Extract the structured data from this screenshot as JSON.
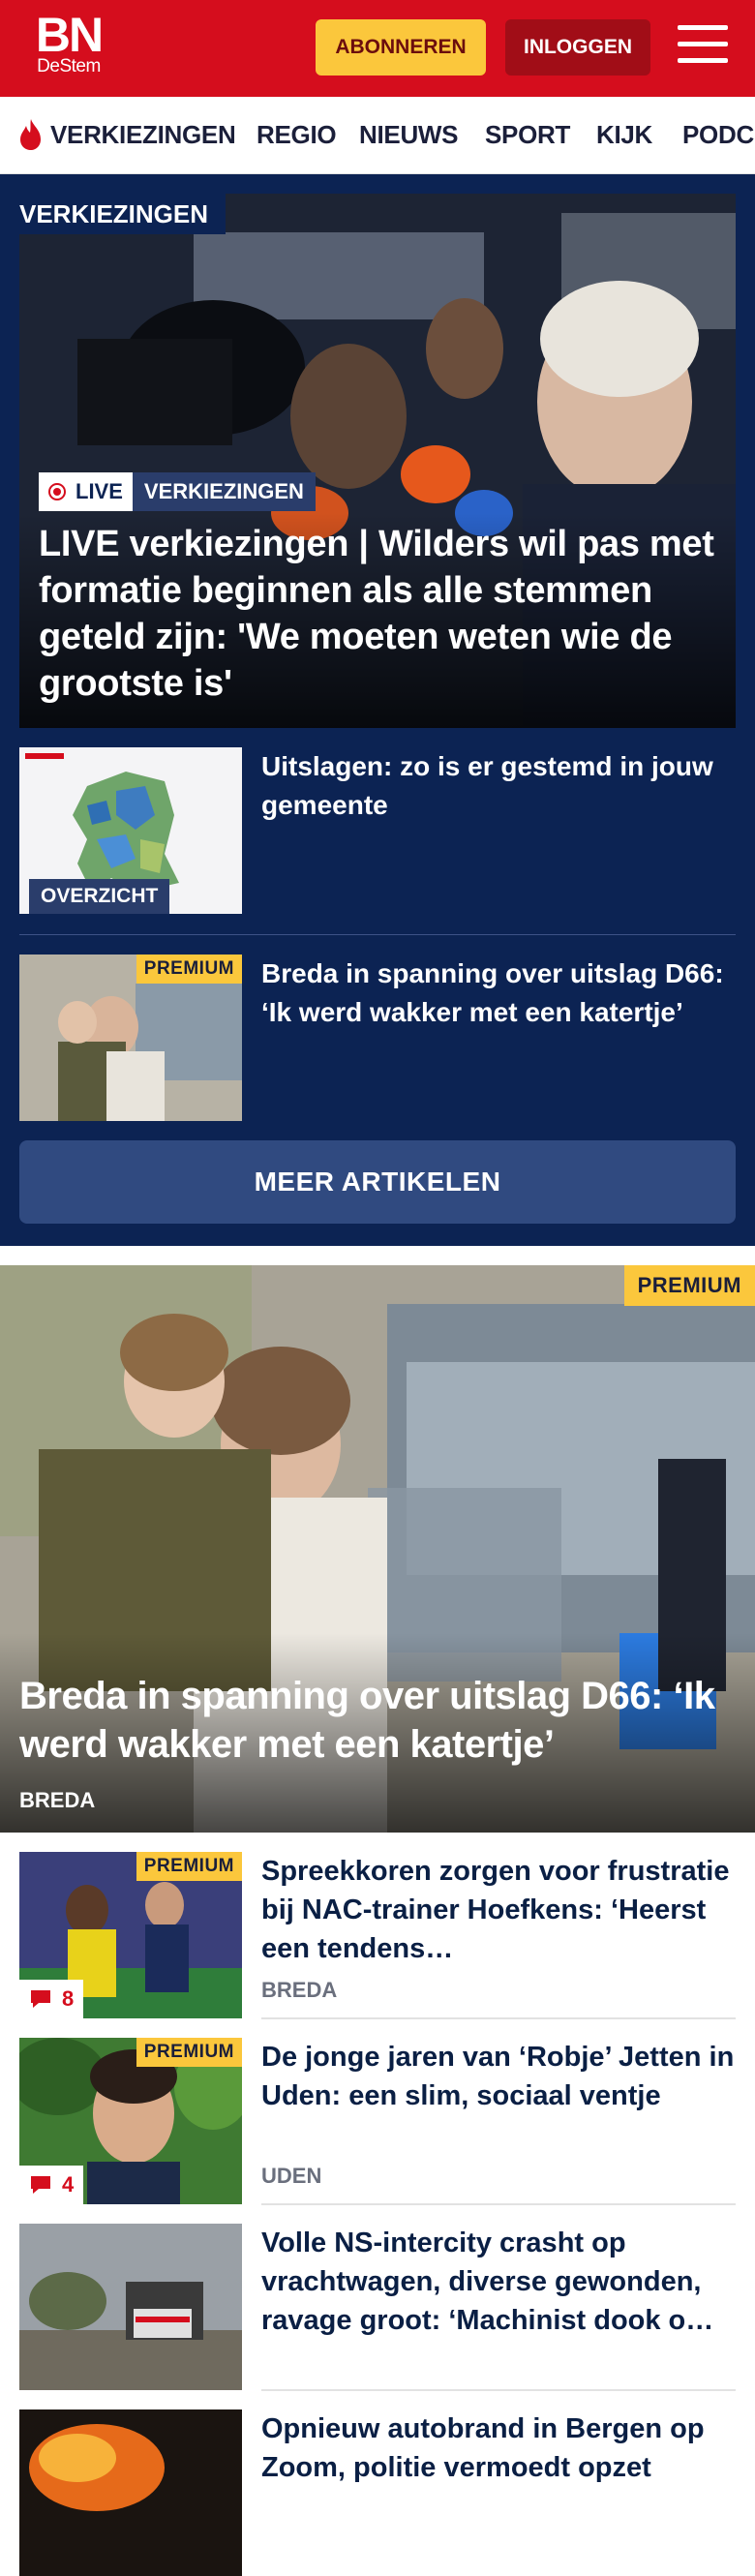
{
  "header": {
    "logo_main": "BN",
    "logo_sub": "DeStem",
    "subscribe_label": "ABONNEREN",
    "login_label": "INLOGGEN",
    "brand_color": "#d50d1d"
  },
  "nav": {
    "items": [
      "VERKIEZINGEN",
      "REGIO",
      "NIEUWS",
      "SPORT",
      "KIJK",
      "PODC"
    ]
  },
  "elections": {
    "section_label": "VERKIEZINGEN",
    "hero": {
      "live_label": "LIVE",
      "category": "VERKIEZINGEN",
      "title": "LIVE verkiezingen | Wilders wil pas met formatie beginnen als alle stemmen geteld zijn: 'We moeten weten wie de grootste is'"
    },
    "items": [
      {
        "title": "Uitslagen: zo is er gestemd in jouw gemeente",
        "badge": "OVERZICHT"
      },
      {
        "title": "Breda in spanning over uitslag D66: ‘Ik werd wakker met een katertje’",
        "badge": "PREMIUM"
      }
    ],
    "more_label": "MEER ARTIKELEN"
  },
  "featured": {
    "badge": "PREMIUM",
    "title": "Breda in spanning over uitslag D66: ‘Ik werd wakker met een katertje’",
    "location": "BREDA"
  },
  "list": [
    {
      "title": "Spreekkoren zorgen voor frustratie bij NAC-trainer Hoefkens: ‘Heerst een tendens…",
      "location": "BREDA",
      "badge": "PREMIUM",
      "comments": "8"
    },
    {
      "title": "De jonge jaren van ‘Robje’ Jetten in Uden: een slim, sociaal ventje",
      "location": "UDEN",
      "badge": "PREMIUM",
      "comments": "4"
    },
    {
      "title": "Volle NS-intercity crasht op vrachtwagen, diverse gewonden, ravage groot: ‘Machinist dook o…",
      "location": "",
      "badge": "",
      "comments": ""
    },
    {
      "title": "Opnieuw autobrand in Bergen op Zoom, politie vermoedt opzet",
      "location": "",
      "badge": "",
      "comments": ""
    }
  ]
}
